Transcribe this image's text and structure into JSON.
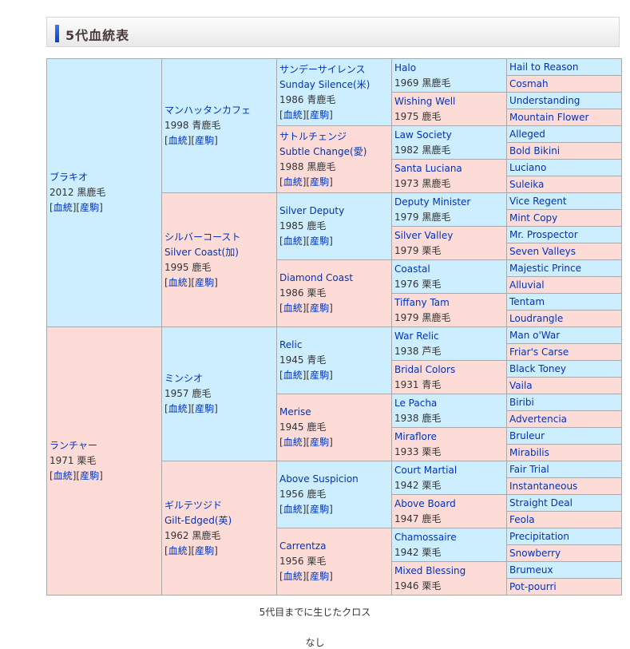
{
  "section_title": "5代血統表",
  "link_labels": {
    "pedigree": "血統",
    "offspring": "産駒"
  },
  "gen1": [
    {
      "name": "ブラキオ",
      "info": "2012 黒鹿毛"
    },
    {
      "name": "ランチャー",
      "info": "1971 栗毛"
    }
  ],
  "gen2": [
    {
      "name": "マンハッタンカフェ",
      "info": "1998 青鹿毛"
    },
    {
      "name": "シルバーコースト",
      "alt": "Silver Coast(加)",
      "info": "1995 鹿毛"
    },
    {
      "name": "ミンシオ",
      "info": "1957 鹿毛"
    },
    {
      "name": "ギルテツジド",
      "alt": "Gilt-Edged(英)",
      "info": "1962 黒鹿毛"
    }
  ],
  "gen3": [
    {
      "name": "サンデーサイレンス",
      "alt": "Sunday Silence(米)",
      "info": "1986 青鹿毛"
    },
    {
      "name": "サトルチェンジ",
      "alt": "Subtle Change(愛)",
      "info": "1988 黒鹿毛"
    },
    {
      "name": "Silver Deputy",
      "info": "1985 鹿毛"
    },
    {
      "name": "Diamond Coast",
      "info": "1986 栗毛"
    },
    {
      "name": "Relic",
      "info": "1945 青毛"
    },
    {
      "name": "Merise",
      "info": "1945 鹿毛"
    },
    {
      "name": "Above Suspicion",
      "info": "1956 鹿毛"
    },
    {
      "name": "Carrentza",
      "info": "1956 栗毛"
    }
  ],
  "gen4": [
    {
      "name": "Halo",
      "info": "1969 黒鹿毛"
    },
    {
      "name": "Wishing Well",
      "info": "1975 鹿毛"
    },
    {
      "name": "Law Society",
      "info": "1982 黒鹿毛"
    },
    {
      "name": "Santa Luciana",
      "info": "1973 黒鹿毛"
    },
    {
      "name": "Deputy Minister",
      "info": "1979 黒鹿毛"
    },
    {
      "name": "Silver Valley",
      "info": "1979 栗毛"
    },
    {
      "name": "Coastal",
      "info": "1976 栗毛"
    },
    {
      "name": "Tiffany Tam",
      "info": "1979 黒鹿毛"
    },
    {
      "name": "War Relic",
      "info": "1938 芦毛"
    },
    {
      "name": "Bridal Colors",
      "info": "1931 青毛"
    },
    {
      "name": "Le Pacha",
      "info": "1938 鹿毛"
    },
    {
      "name": "Miraflore",
      "info": "1933 栗毛"
    },
    {
      "name": "Court Martial",
      "info": "1942 栗毛"
    },
    {
      "name": "Above Board",
      "info": "1947 鹿毛"
    },
    {
      "name": "Chamossaire",
      "info": "1942 栗毛"
    },
    {
      "name": "Mixed Blessing",
      "info": "1946 栗毛"
    }
  ],
  "gen5": [
    {
      "name": "Hail to Reason"
    },
    {
      "name": "Cosmah"
    },
    {
      "name": "Understanding"
    },
    {
      "name": "Mountain Flower"
    },
    {
      "name": "Alleged"
    },
    {
      "name": "Bold Bikini"
    },
    {
      "name": "Luciano"
    },
    {
      "name": "Suleika"
    },
    {
      "name": "Vice Regent"
    },
    {
      "name": "Mint Copy"
    },
    {
      "name": "Mr. Prospector"
    },
    {
      "name": "Seven Valleys"
    },
    {
      "name": "Majestic Prince"
    },
    {
      "name": "Alluvial"
    },
    {
      "name": "Tentam"
    },
    {
      "name": "Loudrangle"
    },
    {
      "name": "Man o'War"
    },
    {
      "name": "Friar's Carse"
    },
    {
      "name": "Black Toney"
    },
    {
      "name": "Vaila"
    },
    {
      "name": "Biribi"
    },
    {
      "name": "Advertencia"
    },
    {
      "name": "Bruleur"
    },
    {
      "name": "Mirabilis"
    },
    {
      "name": "Fair Trial"
    },
    {
      "name": "Instantaneous"
    },
    {
      "name": "Straight Deal"
    },
    {
      "name": "Feola"
    },
    {
      "name": "Precipitation"
    },
    {
      "name": "Snowberry"
    },
    {
      "name": "Brumeux"
    },
    {
      "name": "Pot-pourri"
    }
  ],
  "cross_title": "5代目までに生じたクロス",
  "cross_value": "なし",
  "colors": {
    "sire_bg": "#cdeefe",
    "dam_bg": "#fddcd8",
    "link": "#0033bb"
  }
}
